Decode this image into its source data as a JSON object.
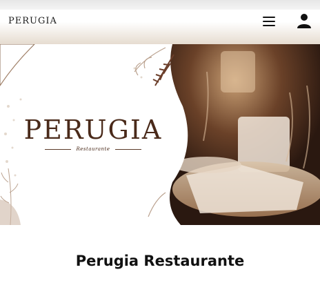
{
  "header": {
    "logo_text": "PERUGIA",
    "menu_icon": "hamburger-menu-icon",
    "account_icon": "user-account-icon"
  },
  "hero": {
    "brand_name": "PERUGIA",
    "brand_subtitle": "Restaurante",
    "brand_color": "#4a2a1a",
    "image_description_tone": "#5a3a22"
  },
  "section": {
    "title": "Perugia Restaurante"
  }
}
